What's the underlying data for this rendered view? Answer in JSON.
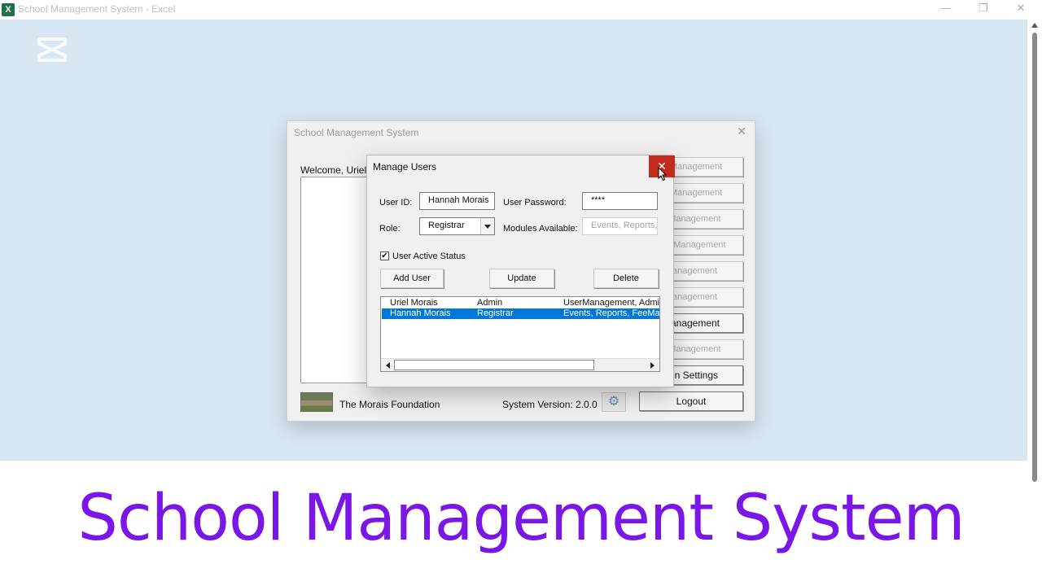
{
  "window": {
    "title": "School Management System - Excel",
    "app_icon": "X",
    "controls": {
      "minimize": "—",
      "restore": "❐",
      "close": "✕"
    }
  },
  "main_dialog": {
    "title": "School Management System",
    "close_glyph": "✕",
    "welcome": "Welcome, Uriel M",
    "side_buttons": [
      {
        "label": "nt Management",
        "active": false
      },
      {
        "label": "nt Management",
        "active": false
      },
      {
        "label": "s Management",
        "active": false
      },
      {
        "label": "nce Management",
        "active": false
      },
      {
        "label": "Management",
        "active": false
      },
      {
        "label": "Management",
        "active": false
      },
      {
        "label": "Management",
        "active": true
      },
      {
        "label": "s Management",
        "active": false
      },
      {
        "label": "min Settings",
        "active": true
      },
      {
        "label": "Logout",
        "active": true
      }
    ],
    "footer": {
      "foundation": "The Morais Foundation",
      "version": "System Version: 2.0.0",
      "gear_icon": "gear-icon"
    }
  },
  "manage_users": {
    "title": "Manage Users",
    "close_glyph": "✕",
    "user_id_label": "User ID:",
    "user_id_value": "Hannah Morais",
    "password_label": "User Password:",
    "password_value": "****",
    "role_label": "Role:",
    "role_value": "Registrar",
    "modules_label": "Modules Available:",
    "modules_value": "Events, Reports, F",
    "active_label": "User Active Status",
    "active_checked": true,
    "add_button": "Add User",
    "update_button": "Update",
    "delete_button": "Delete",
    "users": [
      {
        "name": "Uriel Morais",
        "role": "Admin",
        "modules": "UserManagement, Admin",
        "selected": false
      },
      {
        "name": "Hannah Morais",
        "role": "Registrar",
        "modules": "Events, Reports, FeeMana",
        "selected": true
      }
    ]
  },
  "banner": {
    "text": "School Management System",
    "color": "#7a16e8"
  },
  "colors": {
    "selection": "#0078d7",
    "close_hover": "#c42b1c",
    "excel_green": "#1e7145",
    "desktop_bg": "#d6e6f3"
  }
}
